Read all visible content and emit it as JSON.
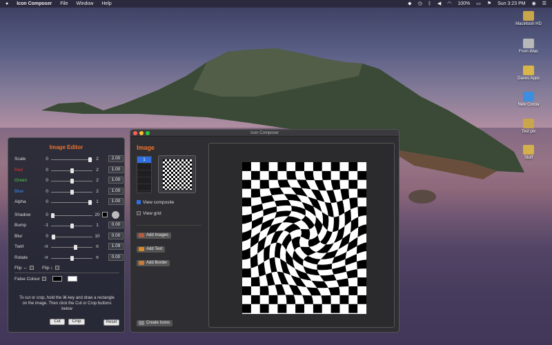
{
  "menubar": {
    "app_name": "Icon Composer",
    "menus": [
      "File",
      "Window",
      "Help"
    ],
    "status": {
      "battery": "100%",
      "clock": "Sun 3:23 PM"
    }
  },
  "desktop_icons": [
    {
      "label": "Macintosh HD"
    },
    {
      "label": "From iMac"
    },
    {
      "label": "Daves Apps"
    },
    {
      "label": "New Cocoa"
    },
    {
      "label": "Test pix"
    },
    {
      "label": "Stuff"
    }
  ],
  "editor": {
    "title": "Image Editor",
    "rows": [
      {
        "label": "Scale",
        "min": "0",
        "max": "2",
        "value": "2.00",
        "fraction": 0.98,
        "color": "#dddddd"
      },
      {
        "label": "Red",
        "min": "0",
        "max": "2",
        "value": "1.00",
        "fraction": 0.5,
        "color": "#e0342c"
      },
      {
        "label": "Green",
        "min": "0",
        "max": "2",
        "value": "1.00",
        "fraction": 0.5,
        "color": "#4fd14a"
      },
      {
        "label": "Blue",
        "min": "0",
        "max": "2",
        "value": "1.00",
        "fraction": 0.5,
        "color": "#3d8df0"
      },
      {
        "label": "Alpha",
        "min": "0",
        "max": "1",
        "value": "1.00",
        "fraction": 0.98,
        "color": "#dddddd"
      }
    ],
    "shadow": {
      "label": "Shadow",
      "min": "0",
      "max": "20",
      "fraction": 0.02
    },
    "rows2": [
      {
        "label": "Bump",
        "min": "-1",
        "max": "1",
        "value": "0.00",
        "fraction": 0.5
      },
      {
        "label": "Blur",
        "min": "0",
        "max": "10",
        "value": "0.00",
        "fraction": 0.02
      },
      {
        "label": "Twirl",
        "min": "-π",
        "max": "π",
        "value": "1.09",
        "fraction": 0.6
      },
      {
        "label": "Rotate",
        "min": "-π",
        "max": "π",
        "value": "0.00",
        "fraction": 0.5
      }
    ],
    "flip_h": "Flip ↔",
    "flip_v": "Flip ↕",
    "false_colour": "False Colour",
    "false_colour_a": "#000000",
    "false_colour_b": "#ffffff",
    "hint": "To cut or crop, hold the ⌘-key and draw a rectangle on the image.  Then click the Cut or Crop buttons below",
    "cut": "Cut",
    "crop": "Crop",
    "reset": "Reset"
  },
  "window": {
    "title": "Icon Composer",
    "heading": "Image",
    "slots": [
      "1",
      "",
      "",
      "",
      ""
    ],
    "view_composite": "View composite",
    "view_grid": "View grid",
    "add_images": "Add Images",
    "add_text": "Add Text",
    "add_border": "Add Border",
    "create_icons": "Create Icons"
  }
}
